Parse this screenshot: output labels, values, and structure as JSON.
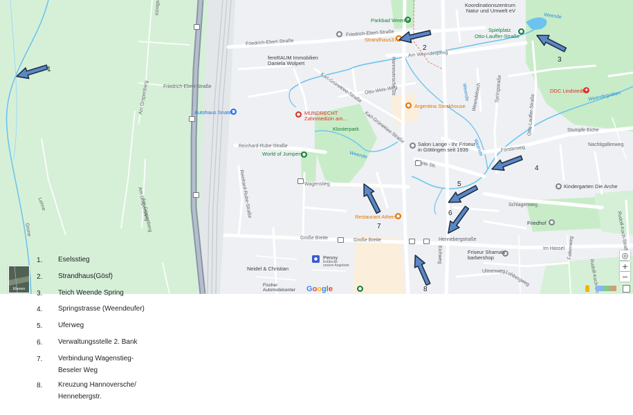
{
  "map": {
    "streets": {
      "koenigsallee": "Königsallee",
      "friedrich_ebert_1": "Friedrich-Ebert-Straße",
      "friedrich_ebert_2": "Friedrich-Ebert-Straße",
      "friedrich_ebert_3": "Friedrich-Ebert-Straße",
      "am_weendespring": "Am Weendespring",
      "karl_grueneklee_1": "Karl-Grüneklee-Straße",
      "karl_grueneklee_2": "Karl-Grüneklee-Straße",
      "otto_wels_weg": "Otto-Wels-Weg",
      "hannoversche": "Hannoversche Str.",
      "am_grapenberg_1": "Am Grapenberg",
      "am_grapenberg_2": "Am Grapenberg",
      "am_grapenberg_3": "Am Grapenberg",
      "reinhard_rube_1": "Reinhard-Rube-Straße",
      "reinhard_rube_2": "Reinhard-Rube-Straße",
      "wagenstieg": "Wagenstieg",
      "grosse_breite_1": "Große Breite",
      "grosse_breite_2": "Große Breite",
      "hennebergstrasse": "Hennebergstraße",
      "breite_str": "Breite Str.",
      "springstrasse": "Springstraße",
      "foersterweg": "Försterweg",
      "otto_lauffer": "Otto-Lauffer-Straße",
      "stumpfe_eiche": "Stumpfe Eiche",
      "nachtigallenweg": "Nachtigallenweg",
      "schlagenweg": "Schlagenweg",
      "im_hassel": "Im Hassel",
      "ulmenweg": "Ulmenweg",
      "falkenweg": "Falkenweg",
      "lohbergweg": "Lohbergweg",
      "ostring": "Eichweg",
      "lehne": "Lehne",
      "grone": "Grone",
      "weende_bach": "Weendebach",
      "rudolf_koch": "Rudolf-Koch-Straße",
      "puppenweg": "Rudolf-Koch-Str."
    },
    "water_labels": {
      "weende_top": "Weende",
      "weende_mid": "Weende",
      "weende_right": "Weende",
      "weende_vertical": "Weende",
      "weendegraben": "Weendegraben"
    },
    "pois": {
      "parkbad": "Parkbad Weende",
      "strandhaus": "Strandhaus37",
      "koordination": "Koordinationszentrum\nNatur und Umwelt eV",
      "spielplatz": "Spielplatz",
      "otto_lauffer_poi": "Otto-Lauffer-Straße",
      "friedrich_ebert_poi": "Friedrich-Ebert-Straße",
      "femraum": "femRAUM Immobilien\nDaniela Wolpert",
      "ddc": "DDC Lindstedt",
      "autohaus": "Autohaus Snater",
      "mundrecht": "MUNDRECHT\nZahnmedizin am...",
      "argentina": "Argentina Steakhouse",
      "klosterpark": "Klosterpark",
      "salon_lange": "Salon Lange - Ihr Friseur\nin Göttingen seit 1939",
      "world_of_jumpers": "World of Jumpers",
      "kindergarten": "Kindergarten Die Arche",
      "restaurant_athen": "Restaurant Athen",
      "friedhof": "Friedhof",
      "friseur": "Friseur Shamals\nbarbershop",
      "penny": "Penny",
      "penny_sub": "Entdecke\nunsere Angebote",
      "neidel": "Neidel & Christian",
      "fischer": "Fischer\nAutomobilcenter",
      "thumb_label": "Ebenen"
    },
    "attribution": "Google",
    "markers": [
      "1",
      "2",
      "3",
      "4",
      "5",
      "6",
      "7",
      "8"
    ],
    "controls": {
      "locate": "◎",
      "zoom_in": "+",
      "zoom_out": "−"
    }
  },
  "legend": [
    {
      "num": "1.",
      "text": "Eselsstieg"
    },
    {
      "num": "2.",
      "text": "Strandhaus(Gösf)"
    },
    {
      "num": "3.",
      "text": "Teich Weende Spring"
    },
    {
      "num": "4.",
      "text": "Springstrasse (Weendeufer)"
    },
    {
      "num": "5.",
      "text": "Uferweg"
    },
    {
      "num": "6.",
      "text": "Verwaltungsstelle 2. Bank"
    },
    {
      "num": "7.",
      "text": "Verbindung Wagenstieg-\nBeseler Weg"
    },
    {
      "num": "8.",
      "text": "Kreuzung Hannoversche/\nHennebergstr."
    }
  ],
  "colors": {
    "park_green": "#c8ecc8",
    "field_green": "#d4f1d4",
    "road": "#ffffff",
    "highway": "#7e8a99",
    "water": "#6cc4ee",
    "arrow_fill": "#5b88c5",
    "arrow_stroke": "#1f2d44"
  }
}
